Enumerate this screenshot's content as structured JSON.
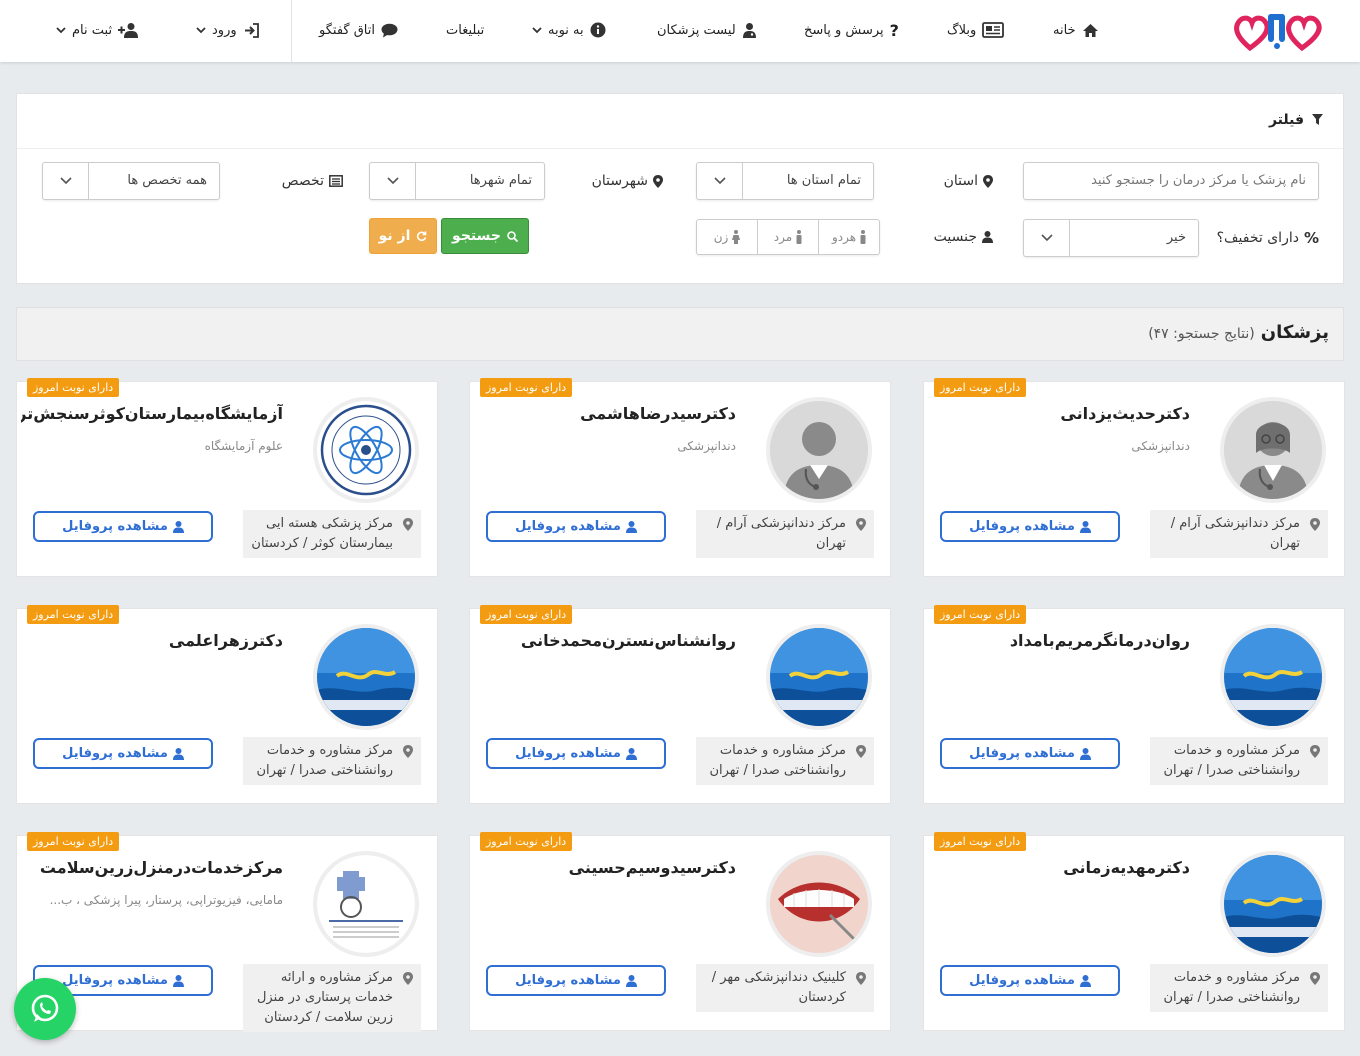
{
  "header": {
    "logo_icon": "heart-logo-icon",
    "nav": {
      "home": "خانه",
      "blog": "وبلاگ",
      "qa": "پرسش و پاسخ",
      "doctors": "لیست پزشکان",
      "booking": "به نوبه",
      "ads": "تبلیغات",
      "chat": "اتاق گفتگو",
      "login": "ورود",
      "register": "ثبت نام"
    }
  },
  "filter": {
    "title": "فیلتر",
    "search_placeholder": "نام پزشک یا مرکز درمان را جستجو کنید",
    "province_label": "استان",
    "province_value": "تمام استان ها",
    "city_label": "شهرستان",
    "city_value": "تمام شهرها",
    "specialty_label": "تخصص",
    "specialty_value": "همه تخصص ها",
    "discount_label": "دارای تخفیف؟",
    "discount_value": "خیر",
    "gender_label": "جنسیت",
    "gender_options": [
      "هردو",
      "مرد",
      "زن"
    ],
    "search_button": "جستجو",
    "reset_button": "از نو"
  },
  "results": {
    "title": "پزشکان",
    "count": "(نتایج جستجو: ۴۷)"
  },
  "common": {
    "badge": "دارای نوبت امروز",
    "profile_button": "مشاهده پروفایل"
  },
  "cards": [
    {
      "name": "دکترحدیث‌یزدانی",
      "specialty": "دندانپزشکی",
      "location": "مرکز دندانپزشکی آرام / تهران",
      "avatar": "female-doctor-avatar"
    },
    {
      "name": "دکترسیدرضاهاشمی",
      "specialty": "دندانپزشکی",
      "location": "مرکز دندانپزشکی آرام / تهران",
      "avatar": "male-doctor-avatar"
    },
    {
      "name": "آزمایشگاه‌بیمارستان‌کوثرسنجش‌تراکم‌استخوان",
      "specialty": "علوم آزمایشگاه",
      "location": "مرکز پزشکی هسته ایی بیمارستان کوثر / کردستان",
      "avatar": "nuclear-medicine-logo"
    },
    {
      "name": "روان‌درمانگرمریم‌بامداد",
      "specialty": "",
      "location": "مرکز مشاوره و خدمات روانشناختی صدرا / تهران",
      "avatar": "sadra-logo"
    },
    {
      "name": "روانشناس‌نسترن‌محمدخانی",
      "specialty": "",
      "location": "مرکز مشاوره و خدمات روانشناختی صدرا / تهران",
      "avatar": "sadra-logo"
    },
    {
      "name": "دکترزهراعلمی",
      "specialty": "",
      "location": "مرکز مشاوره و خدمات روانشناختی صدرا / تهران",
      "avatar": "sadra-logo"
    },
    {
      "name": "دکترمهدیه‌زمانی",
      "specialty": "",
      "location": "مرکز مشاوره و خدمات روانشناختی صدرا / تهران",
      "avatar": "sadra-logo"
    },
    {
      "name": "دکترسیدوسیم‌حسینی",
      "specialty": "",
      "location": "کلینیک دندانپزشکی مهر / کردستان",
      "avatar": "teeth-photo"
    },
    {
      "name": "مرکزخدمات‌درمنزل‌زرین‌سلامت",
      "specialty": "مامایی، فیزیوتراپی، پرستار، پیرا پزشکی ، ب...",
      "location": "مرکز مشاوره و ارائه خدمات پرستاری در منزل زرین سلامت / کردستان",
      "avatar": "zarin-salamat-logo"
    }
  ],
  "colors": {
    "primary_blue": "#2f6fd4",
    "badge_orange": "#f39c12",
    "search_green": "#4cae4c",
    "reset_orange": "#f0ad4e",
    "whatsapp_green": "#25d366"
  }
}
